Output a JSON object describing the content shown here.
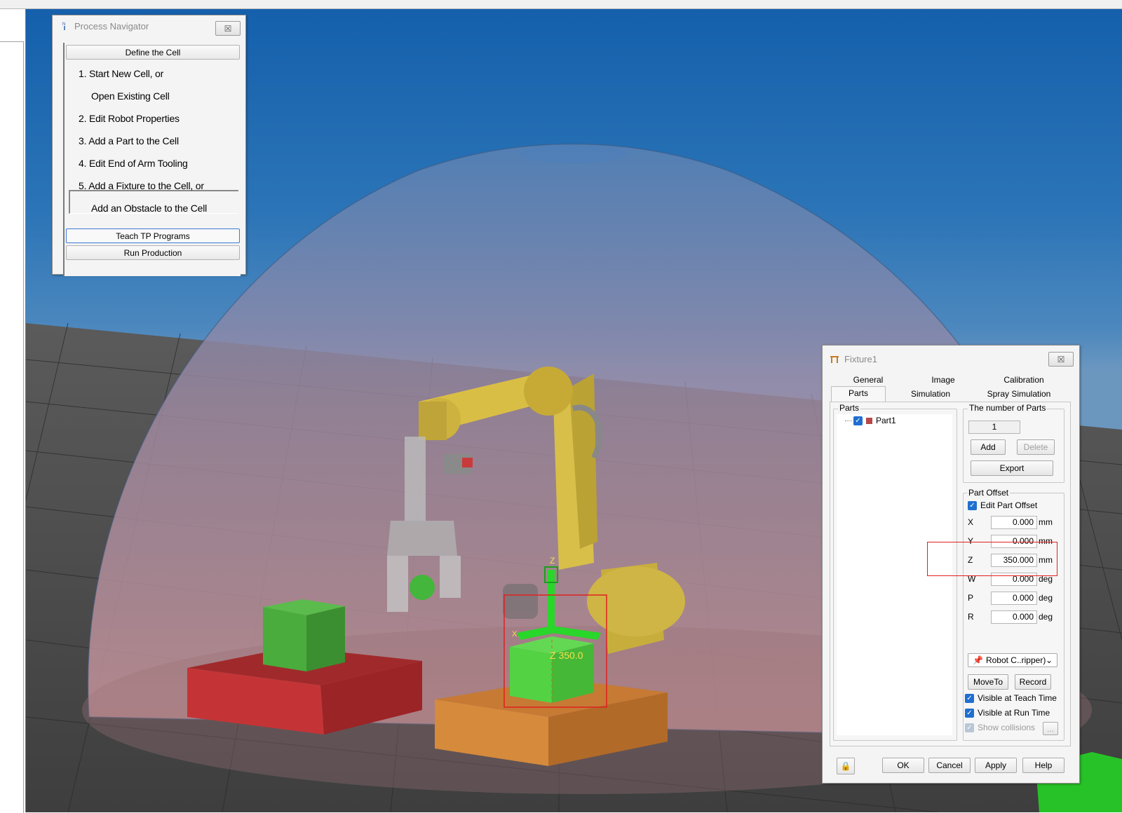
{
  "process_navigator": {
    "title": "Process Navigator",
    "define_cell_button": "Define the Cell",
    "steps": [
      "1.  Start New Cell, or",
      "Open Existing Cell",
      "2.  Edit Robot Properties",
      "3.  Add a Part to the Cell",
      "4.  Edit End of Arm Tooling",
      "5.  Add a Fixture to the Cell, or",
      "Add an Obstacle to the Cell"
    ],
    "teach_button": "Teach TP Programs",
    "run_button": "Run Production"
  },
  "viewport": {
    "z_readout": "Z 350.0",
    "axis_z_label": "Z",
    "axis_x_label": "X"
  },
  "fixture_dialog": {
    "title": "Fixture1",
    "tabs_back": [
      "General",
      "Image",
      "Calibration"
    ],
    "tabs_front": [
      "Parts",
      "Simulation",
      "Spray Simulation"
    ],
    "active_tab": "Parts",
    "parts_group_label": "Parts",
    "part_items": [
      "Part1"
    ],
    "number_group_label": "The number of Parts",
    "number_value": "1",
    "add_button": "Add",
    "delete_button": "Delete",
    "export_button": "Export",
    "offset_group_label": "Part Offset",
    "edit_offset_label": "Edit Part Offset",
    "offsets": [
      {
        "axis": "X",
        "value": "0.000",
        "unit": "mm"
      },
      {
        "axis": "Y",
        "value": "0.000",
        "unit": "mm"
      },
      {
        "axis": "Z",
        "value": "350.000",
        "unit": "mm"
      },
      {
        "axis": "W",
        "value": "0.000",
        "unit": "deg"
      },
      {
        "axis": "P",
        "value": "0.000",
        "unit": "deg"
      },
      {
        "axis": "R",
        "value": "0.000",
        "unit": "deg"
      }
    ],
    "robot_select": "Robot C..ripper)",
    "moveto_button": "MoveTo",
    "record_button": "Record",
    "visible_teach_label": "Visible at Teach Time",
    "visible_run_label": "Visible at Run Time",
    "show_collisions_label": "Show collisions",
    "ellipsis_button": "...",
    "ok_button": "OK",
    "cancel_button": "Cancel",
    "apply_button": "Apply",
    "help_button": "Help"
  },
  "colors": {
    "sky": "#1a63ad",
    "highlight_red": "#e02020",
    "checkbox_blue": "#1f6fcf",
    "robot_yellow": "#d9be45"
  }
}
